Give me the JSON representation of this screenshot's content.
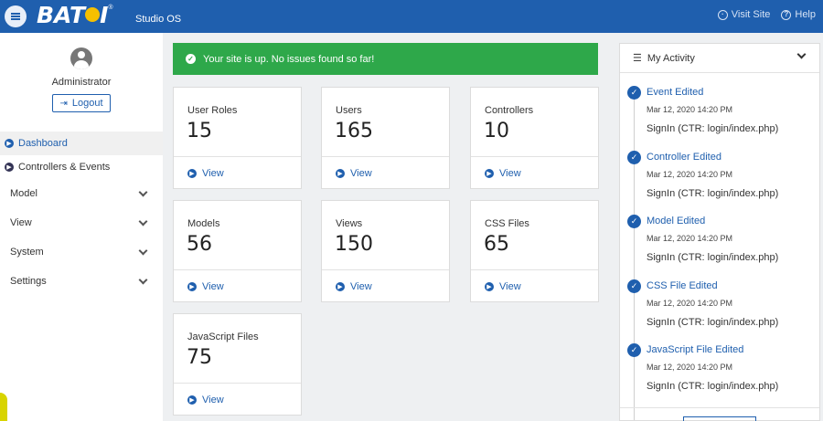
{
  "header": {
    "brand": "BAT",
    "brand_tail": "I",
    "reg": "®",
    "product": "Studio OS",
    "visit_site": "Visit Site",
    "help": "Help"
  },
  "sidebar": {
    "user": "Administrator",
    "logout": "Logout",
    "items": [
      {
        "label": "Dashboard"
      },
      {
        "label": "Controllers & Events"
      }
    ],
    "groups": [
      {
        "label": "Model"
      },
      {
        "label": "View"
      },
      {
        "label": "System"
      },
      {
        "label": "Settings"
      }
    ]
  },
  "alert": {
    "text": "Your site is up. No issues found so far!"
  },
  "cards": [
    {
      "label": "User Roles",
      "value": "15",
      "link": "View"
    },
    {
      "label": "Users",
      "value": "165",
      "link": "View"
    },
    {
      "label": "Controllers",
      "value": "10",
      "link": "View"
    },
    {
      "label": "Models",
      "value": "56",
      "link": "View"
    },
    {
      "label": "Views",
      "value": "150",
      "link": "View"
    },
    {
      "label": "CSS Files",
      "value": "65",
      "link": "View"
    },
    {
      "label": "JavaScript Files",
      "value": "75",
      "link": "View"
    }
  ],
  "activity": {
    "title": "My Activity",
    "items": [
      {
        "title": "Event Edited",
        "date": "Mar 12, 2020 14:20 PM",
        "detail": "SignIn (CTR: login/index.php)"
      },
      {
        "title": "Controller Edited",
        "date": "Mar 12, 2020 14:20 PM",
        "detail": "SignIn (CTR: login/index.php)"
      },
      {
        "title": "Model Edited",
        "date": "Mar 12, 2020 14:20 PM",
        "detail": "SignIn (CTR: login/index.php)"
      },
      {
        "title": "CSS File Edited",
        "date": "Mar 12, 2020 14:20 PM",
        "detail": "SignIn (CTR: login/index.php)"
      },
      {
        "title": "JavaScript File Edited",
        "date": "Mar 12, 2020 14:20 PM",
        "detail": "SignIn (CTR: login/index.php)"
      }
    ]
  },
  "colors": {
    "primary": "#1f5fae",
    "success": "#2ea84a",
    "brand_accent": "#f5c000"
  }
}
